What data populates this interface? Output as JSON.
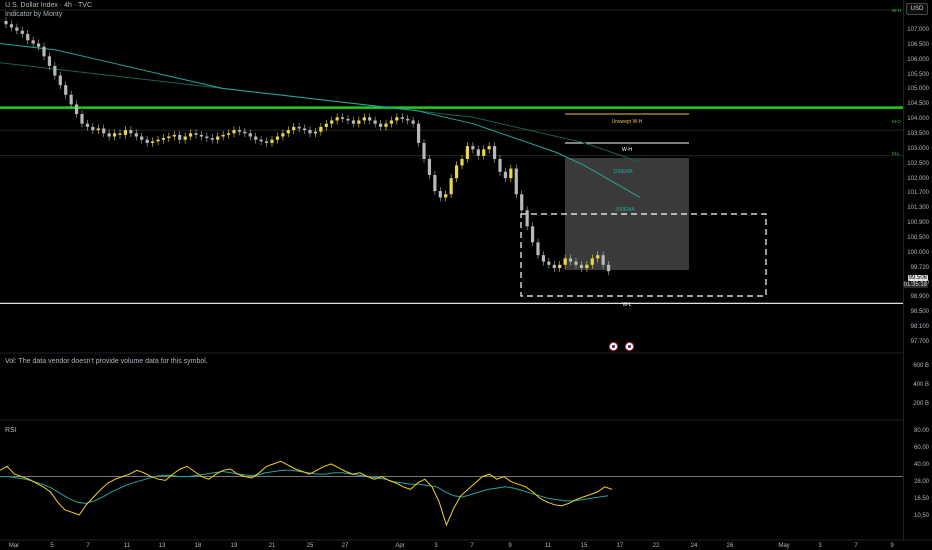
{
  "header": {
    "symbol_line": "U.S. Dollar Index · 4h · TVC",
    "indicator_line": "Indicator by Monty",
    "volume_note": "Vol: The data vendor doesn't provide volume data for this symbol.",
    "rsi_label": "RSI"
  },
  "currency_button": "USD",
  "price_ticks": [
    "107.000",
    "106.500",
    "106.000",
    "105.500",
    "105.000",
    "104.500",
    "104.000",
    "103.500",
    "103.000",
    "102.500",
    "102.000",
    "101.700",
    "101.300",
    "100.900",
    "100.500",
    "100.000",
    "99.720",
    "99.300",
    "98.900",
    "98.500",
    "98.100",
    "97.700"
  ],
  "price_badge": {
    "price": "99.506",
    "countdown": "01:35:18"
  },
  "volume_ticks": [
    "600 B",
    "400 B",
    "200 B"
  ],
  "rsi_ticks": [
    "80.00",
    "60.00",
    "40.00",
    "28.00",
    "16.50",
    "10.50"
  ],
  "x_labels": [
    "Mar",
    "5",
    "7",
    "11",
    "13",
    "18",
    "19",
    "21",
    "25",
    "27",
    "Apr",
    "3",
    "7",
    "9",
    "11",
    "15",
    "17",
    "22",
    "24",
    "26",
    "May",
    "3",
    "7",
    "9"
  ],
  "level_tags": {
    "wh": "W-H",
    "mo": "M-O",
    "ml": "M-L"
  },
  "annotations": {
    "unswept": "Unswept W-H",
    "wh": "W-H",
    "wl": "W-L",
    "ema1": "100EMA",
    "ema2": "200EMA"
  },
  "colors": {
    "bull": "#e8d84a",
    "bear": "#b8b8b8",
    "level_green": "#22cc22",
    "ma1": "#26a69a",
    "ma2": "#1b5e4f",
    "rsi": "#f5d01f",
    "rsi_ma": "#26a69a",
    "box": "#3a3a3a"
  },
  "chart_data": {
    "type": "candlestick",
    "closes": [
      107.2,
      107.1,
      107.0,
      106.9,
      106.7,
      106.6,
      106.5,
      106.2,
      105.9,
      105.6,
      105.3,
      105.0,
      104.7,
      104.4,
      104.1,
      104.0,
      103.9,
      103.95,
      103.8,
      103.7,
      103.8,
      103.75,
      103.9,
      103.8,
      103.7,
      103.6,
      103.5,
      103.55,
      103.6,
      103.65,
      103.7,
      103.75,
      103.6,
      103.7,
      103.8,
      103.75,
      103.7,
      103.65,
      103.6,
      103.7,
      103.75,
      103.8,
      103.9,
      103.85,
      103.8,
      103.7,
      103.6,
      103.55,
      103.5,
      103.6,
      103.7,
      103.8,
      103.9,
      104.0,
      103.95,
      103.9,
      103.8,
      103.85,
      104.0,
      104.1,
      104.2,
      104.3,
      104.25,
      104.2,
      104.1,
      104.2,
      104.3,
      104.2,
      104.1,
      104.0,
      104.1,
      104.2,
      104.3,
      104.25,
      104.2,
      104.1,
      103.5,
      103.0,
      102.5,
      102.0,
      101.8,
      101.9,
      102.4,
      102.8,
      103.0,
      103.4,
      103.3,
      103.1,
      103.3,
      103.4,
      103.0,
      102.6,
      102.4,
      102.7,
      101.9,
      101.4,
      100.9,
      100.4,
      100.0,
      99.8,
      99.7,
      99.6,
      99.7,
      99.9,
      99.8,
      99.7,
      99.6,
      99.7,
      99.9,
      100.0,
      99.7,
      99.5
    ],
    "ma1": [
      106.6,
      106.5,
      106.4,
      106.2,
      106.0,
      105.8,
      105.6,
      105.4,
      105.2,
      105.1,
      105.0,
      104.9,
      104.8,
      104.7,
      104.6,
      104.5,
      104.3,
      104.1,
      103.8,
      103.5,
      103.2,
      102.8,
      102.3,
      101.8
    ],
    "ma2": [
      106.0,
      105.9,
      105.8,
      105.7,
      105.6,
      105.5,
      105.4,
      105.3,
      105.2,
      105.1,
      105.0,
      104.9,
      104.8,
      104.7,
      104.6,
      104.5,
      104.4,
      104.3,
      104.1,
      103.9,
      103.7,
      103.5,
      103.2,
      102.9
    ],
    "levels": {
      "wh": 104.6,
      "mo": 103.9,
      "ml": 103.1,
      "bottom": 98.5
    },
    "rsi": [
      55,
      58,
      52,
      50,
      48,
      45,
      42,
      38,
      30,
      24,
      22,
      20,
      28,
      34,
      40,
      45,
      48,
      50,
      52,
      55,
      53,
      50,
      48,
      47,
      52,
      56,
      58,
      54,
      50,
      48,
      52,
      55,
      56,
      52,
      50,
      49,
      53,
      58,
      60,
      62,
      59,
      56,
      54,
      52,
      55,
      58,
      60,
      57,
      54,
      52,
      53,
      50,
      48,
      50,
      47,
      45,
      42,
      40,
      45,
      48,
      42,
      30,
      12,
      25,
      35,
      40,
      45,
      50,
      52,
      48,
      50,
      46,
      44,
      42,
      38,
      33,
      30,
      28,
      27,
      29,
      32,
      34,
      36,
      38,
      42,
      40
    ],
    "rsi_ma": [
      50,
      50,
      49,
      48,
      46,
      44,
      41,
      37,
      33,
      30,
      29,
      31,
      34,
      38,
      41,
      44,
      46,
      48,
      50,
      51,
      51,
      50,
      50,
      51,
      52,
      53,
      54,
      53,
      52,
      51,
      51,
      53,
      54,
      55,
      55,
      54,
      53,
      52,
      52,
      53,
      53,
      52,
      51,
      50,
      49,
      48,
      46,
      45,
      44,
      44,
      43,
      42,
      38,
      35,
      34,
      36,
      38,
      40,
      41,
      42,
      41,
      39,
      37,
      35,
      33,
      32,
      31,
      31,
      32,
      33,
      34,
      35
    ]
  }
}
